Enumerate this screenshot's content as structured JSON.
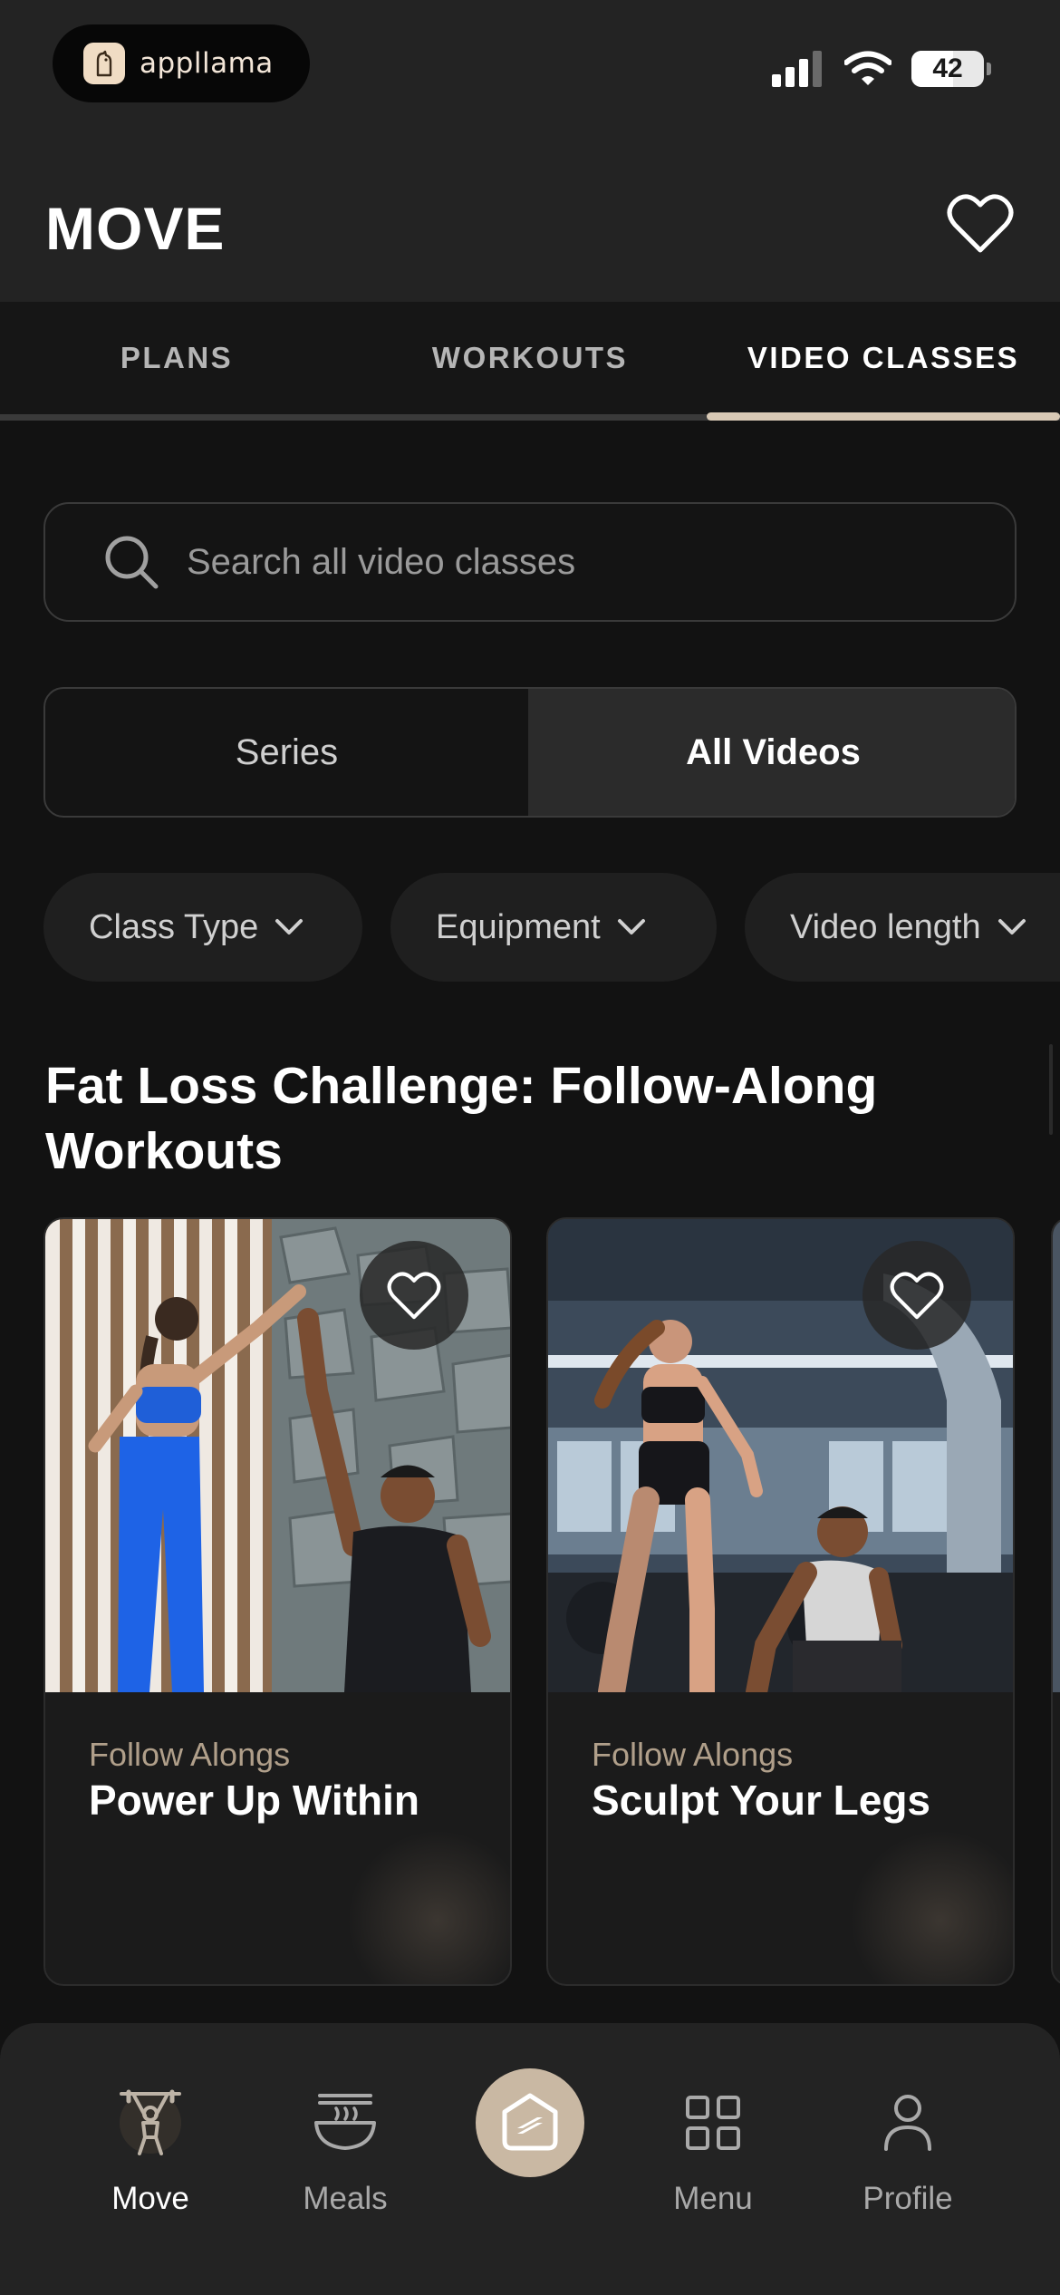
{
  "status_bar": {
    "app_name": "appllama",
    "app_icon": "llama-logo-icon",
    "battery": "42",
    "icons": [
      "cellular-signal-icon",
      "wifi-icon",
      "battery-icon"
    ]
  },
  "header": {
    "title": "MOVE",
    "favorite_icon": "heart-outline-icon"
  },
  "tabs": [
    {
      "label": "PLANS",
      "active": false
    },
    {
      "label": "WORKOUTS",
      "active": false
    },
    {
      "label": "VIDEO CLASSES",
      "active": true
    }
  ],
  "search": {
    "placeholder": "Search all video classes",
    "icon": "search-icon"
  },
  "segment": {
    "options": [
      {
        "label": "Series",
        "selected": false
      },
      {
        "label": "All Videos",
        "selected": true
      }
    ]
  },
  "filters": [
    {
      "label": "Class Type",
      "icon": "chevron-down-icon"
    },
    {
      "label": "Equipment",
      "icon": "chevron-down-icon"
    },
    {
      "label": "Video length",
      "icon": "chevron-down-icon"
    }
  ],
  "section": {
    "title": "Fat Loss Challenge: Follow-Along Workouts"
  },
  "cards": [
    {
      "category": "Follow Alongs",
      "title": "Power Up Within",
      "favorite_icon": "heart-outline-icon"
    },
    {
      "category": "Follow Alongs",
      "title": "Sculpt Your Legs",
      "favorite_icon": "heart-outline-icon"
    }
  ],
  "bottom_nav": [
    {
      "label": "Move",
      "icon": "weightlifter-icon",
      "active": true
    },
    {
      "label": "Meals",
      "icon": "bowl-icon",
      "active": false
    },
    {
      "label": "",
      "icon": "sweat-logo-icon",
      "active": false
    },
    {
      "label": "Menu",
      "icon": "grid-icon",
      "active": false
    },
    {
      "label": "Profile",
      "icon": "person-icon",
      "active": false
    }
  ],
  "colors": {
    "background": "#121212",
    "header": "#232323",
    "accent": "#d8c9b5",
    "category_text": "#b09f8a"
  }
}
